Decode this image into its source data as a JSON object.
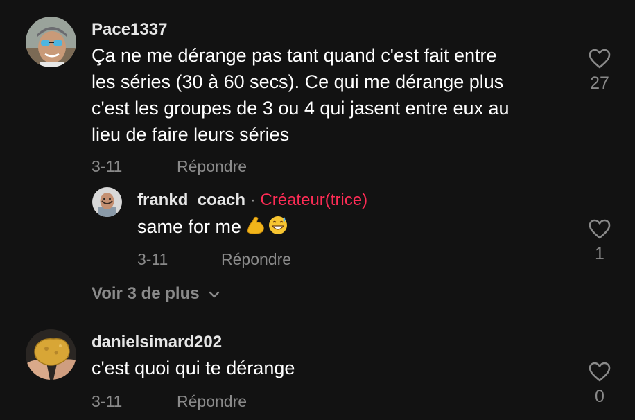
{
  "comments": [
    {
      "username": "Pace1337",
      "text_lines": [
        "Ça ne me dérange pas tant quand c'est fait entre",
        "les séries (30 à 60 secs). Ce qui me dérange plus",
        "c'est les groupes de 3 ou 4 qui jasent entre eux au",
        "lieu de faire leurs séries"
      ],
      "date": "3-11",
      "reply_label": "Répondre",
      "likes": "27",
      "avatar_icon": "man-sunglasses-avatar"
    },
    {
      "username": "danielsimard202",
      "text": "c'est quoi qui te dérange",
      "date": "3-11",
      "reply_label": "Répondre",
      "likes": "0",
      "avatar_icon": "hands-holding-gold-avatar"
    }
  ],
  "reply": {
    "username": "frankd_coach",
    "separator": "·",
    "creator_badge": "Créateur(trice)",
    "text": "same for me",
    "emojis": [
      "flexed-biceps-emoji",
      "grinning-sweat-emoji"
    ],
    "date": "3-11",
    "reply_label": "Répondre",
    "likes": "1",
    "avatar_icon": "bald-man-avatar"
  },
  "view_more": {
    "label": "Voir 3 de plus",
    "icon": "chevron-down-icon"
  },
  "colors": {
    "background": "#121212",
    "creator": "#fe2c55",
    "muted": "#8a8a8a"
  }
}
